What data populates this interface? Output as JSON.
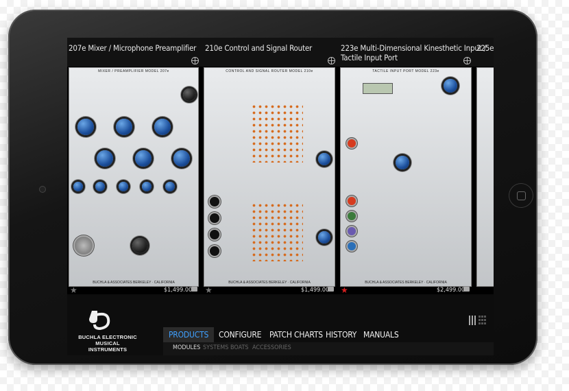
{
  "modules": [
    {
      "title": "207e Mixer / Microphone Preamplifier",
      "panel_label": "MIXER / PREAMPLIFIER MODEL 207e",
      "maker": "BUCHLA & ASSOCIATES   BERKELEY · CALIFORNIA",
      "price": "$1,499.00",
      "favorite": false
    },
    {
      "title": "210e Control and Signal Router",
      "panel_label": "CONTROL AND SIGNAL ROUTER MODEL 210e",
      "maker": "BUCHLA & ASSOCIATES   BERKELEY · CALIFORNIA",
      "price": "$1,499.00",
      "favorite": false
    },
    {
      "title_line1": "223e Multi-Dimensional Kinesthetic Input /",
      "title_line2": "Tactile Input Port",
      "panel_label": "TACTILE INPUT PORT MODEL 223e",
      "maker": "BUCHLA & ASSOCIATES   BERKELEY · CALIFORNIA",
      "price": "$2,499.00",
      "favorite": true
    },
    {
      "title": "225e",
      "panel_label": ""
    }
  ],
  "brand": {
    "line1": "BUCHLA ELECTRONIC",
    "line2": "MUSICAL INSTRUMENTS"
  },
  "nav": [
    {
      "label": "PRODUCTS",
      "active": true
    },
    {
      "label": "CONFIGURE",
      "active": false
    },
    {
      "label": "PATCH CHARTS",
      "active": false
    },
    {
      "label": "HISTORY",
      "active": false
    },
    {
      "label": "MANUALS",
      "active": false
    }
  ],
  "subnav": [
    {
      "label": "MODULES",
      "active": true
    },
    {
      "label": "SYSTEMS",
      "active": false
    },
    {
      "label": "BOATS",
      "active": false
    },
    {
      "label": "ACCESSORIES",
      "active": false
    }
  ],
  "icons": {
    "star": "star-icon",
    "cart": "cart-icon",
    "crosshair": "crosshair-icon",
    "list_view": "list-view-icon",
    "grid_view": "grid-view-icon"
  },
  "colors": {
    "nav_active": "#3fa0ff",
    "favorite": "#d42020"
  }
}
